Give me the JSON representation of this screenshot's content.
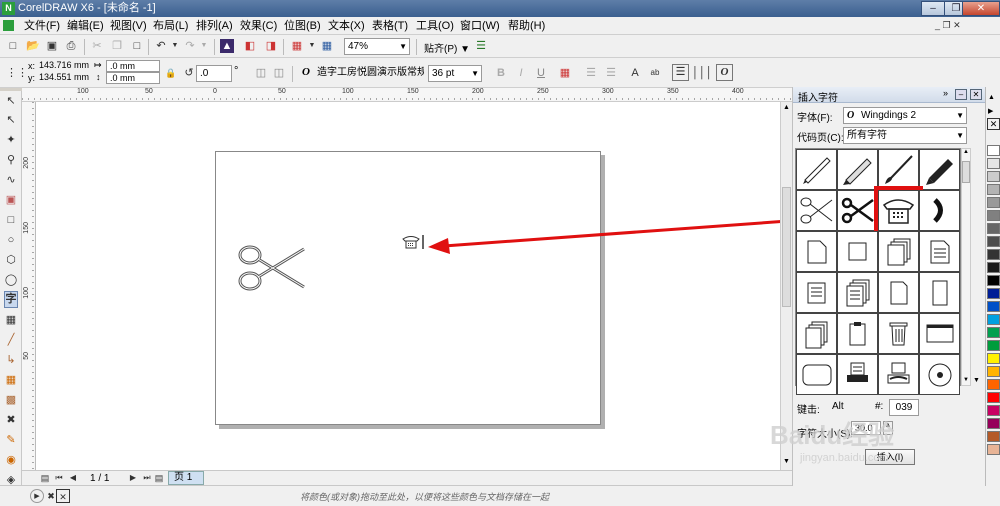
{
  "window": {
    "title": "CorelDRAW X6 - [未命名 -1]"
  },
  "menu": [
    "文件(F)",
    "编辑(E)",
    "视图(V)",
    "布局(L)",
    "排列(A)",
    "效果(C)",
    "位图(B)",
    "文本(X)",
    "表格(T)",
    "工具(O)",
    "窗口(W)",
    "帮助(H)"
  ],
  "toolbar": {
    "zoom": "47%",
    "snap": "贴齐(P)"
  },
  "propbar": {
    "x": "143.716 mm",
    "y": "134.551 mm",
    "w": ".0 mm",
    "h": ".0 mm",
    "angle": ".0",
    "angle_unit": "°",
    "font": "造字工房悦圆演示版常规",
    "size": "36 pt"
  },
  "ruler": {
    "h_labels": [
      "100",
      "50",
      "0",
      "50",
      "100",
      "150",
      "200",
      "250",
      "300",
      "350",
      "400"
    ],
    "v_labels": [
      "200",
      "150",
      "100",
      "50"
    ]
  },
  "pagebar": {
    "counter": "1 / 1",
    "tab": "页 1"
  },
  "status": {
    "hint": "将颜色(或对象)拖动至此处，以便将这些颜色与文档存储在一起"
  },
  "docker": {
    "title": "插入字符",
    "font_label": "字体(F):",
    "font_value": "Wingdings 2",
    "codepage_label": "代码页(C):",
    "codepage_value": "所有字符",
    "keystroke_label": "键击:",
    "keystroke_value": "039",
    "size_label": "字符大小(S):",
    "size_value": "30.0",
    "insert_button": "插入(I)"
  },
  "palette_colors": [
    "#ffffff",
    "#e6e6e6",
    "#cccccc",
    "#b3b3b3",
    "#999999",
    "#808080",
    "#666666",
    "#4d4d4d",
    "#333333",
    "#1a1a1a",
    "#000000",
    "#001e96",
    "#0050c8",
    "#00a0e0",
    "#00a050",
    "#009c3c",
    "#fff000",
    "#ffb400",
    "#ff6400",
    "#ff0000",
    "#c80064",
    "#96005a",
    "#b45a28",
    "#e8b496"
  ],
  "watermark": {
    "brand": "Baidu经验",
    "url": "jingyan.baidu.com"
  }
}
